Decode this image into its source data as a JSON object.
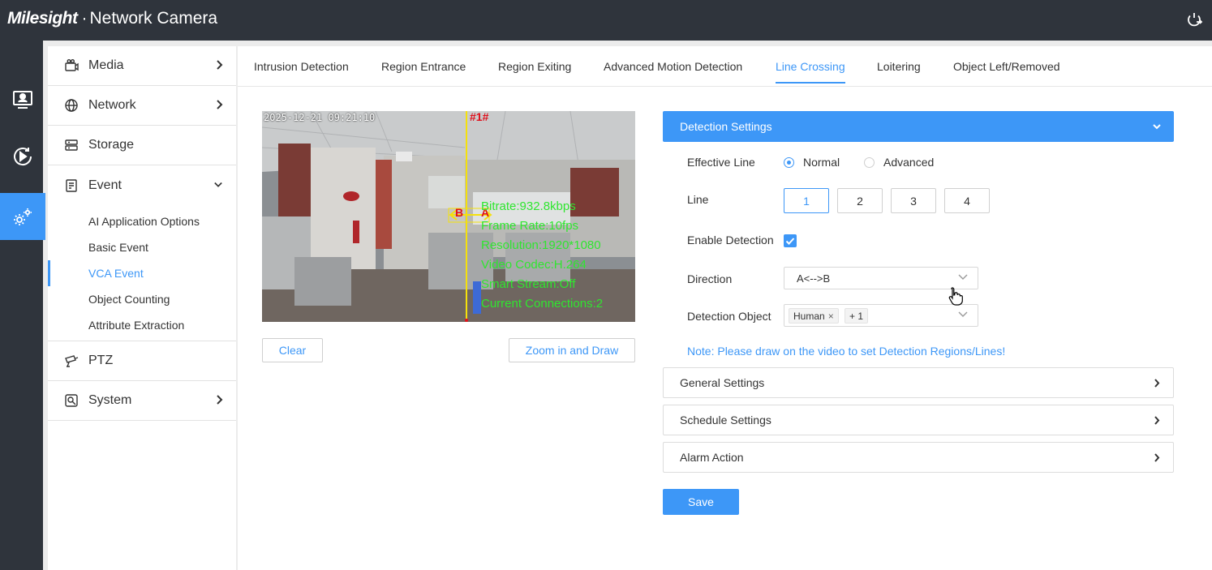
{
  "header": {
    "logo": "Milesight",
    "product": "Network Camera",
    "icons": [
      "logout-icon"
    ]
  },
  "rail": {
    "items": [
      {
        "icon": "live-view-icon",
        "active": false
      },
      {
        "icon": "playback-icon",
        "active": false
      },
      {
        "icon": "settings-icon",
        "active": true
      }
    ]
  },
  "sidebar": {
    "items": [
      {
        "label": "Media",
        "icon": "camera-icon",
        "expandable": true
      },
      {
        "label": "Network",
        "icon": "globe-icon",
        "expandable": true
      },
      {
        "label": "Storage",
        "icon": "storage-icon",
        "expandable": false
      },
      {
        "label": "Event",
        "icon": "event-icon",
        "expanded": true
      }
    ],
    "event_children": [
      {
        "label": "AI Application Options"
      },
      {
        "label": "Basic Event"
      },
      {
        "label": "VCA Event",
        "active": true
      },
      {
        "label": "Object Counting"
      },
      {
        "label": "Attribute Extraction"
      }
    ],
    "bottom_items": [
      {
        "label": "PTZ",
        "icon": "ptz-icon"
      },
      {
        "label": "System",
        "icon": "system-icon",
        "expandable": true
      }
    ]
  },
  "tabs": [
    {
      "label": "Intrusion Detection"
    },
    {
      "label": "Region Entrance"
    },
    {
      "label": "Region Exiting"
    },
    {
      "label": "Advanced Motion Detection"
    },
    {
      "label": "Line Crossing",
      "active": true
    },
    {
      "label": "Loitering"
    },
    {
      "label": "Object Left/Removed"
    }
  ],
  "video": {
    "timestamp": "2025-12-21 09:21:10",
    "line_label": "#1#",
    "point_a": "A",
    "point_b": "B",
    "stats": [
      "Bitrate:932.8kbps",
      "Frame Rate:10fps",
      "Resolution:1920*1080",
      "Video Codec:H.264",
      "Smart Stream:Off",
      "Current Connections:2"
    ],
    "clear_label": "Clear",
    "zoom_label": "Zoom in and Draw"
  },
  "detection": {
    "header": "Detection Settings",
    "effective_line_label": "Effective Line",
    "effective_options": [
      "Normal",
      "Advanced"
    ],
    "effective_selected": "Normal",
    "line_label": "Line",
    "lines": [
      "1",
      "2",
      "3",
      "4"
    ],
    "line_selected": "1",
    "enable_label": "Enable Detection",
    "enable_checked": true,
    "direction_label": "Direction",
    "direction_value": "A<-->B",
    "object_label": "Detection Object",
    "object_tag": "Human",
    "object_more": "+ 1",
    "note": "Note: Please draw on the video to set Detection Regions/Lines!"
  },
  "sections": [
    "General Settings",
    "Schedule Settings",
    "Alarm Action"
  ],
  "save_label": "Save",
  "colors": {
    "accent": "#3d97f7",
    "dark": "#2f343c",
    "osd_green": "#2fe62f",
    "line_yellow": "#f5e10b",
    "line_red": "#e0101c"
  }
}
